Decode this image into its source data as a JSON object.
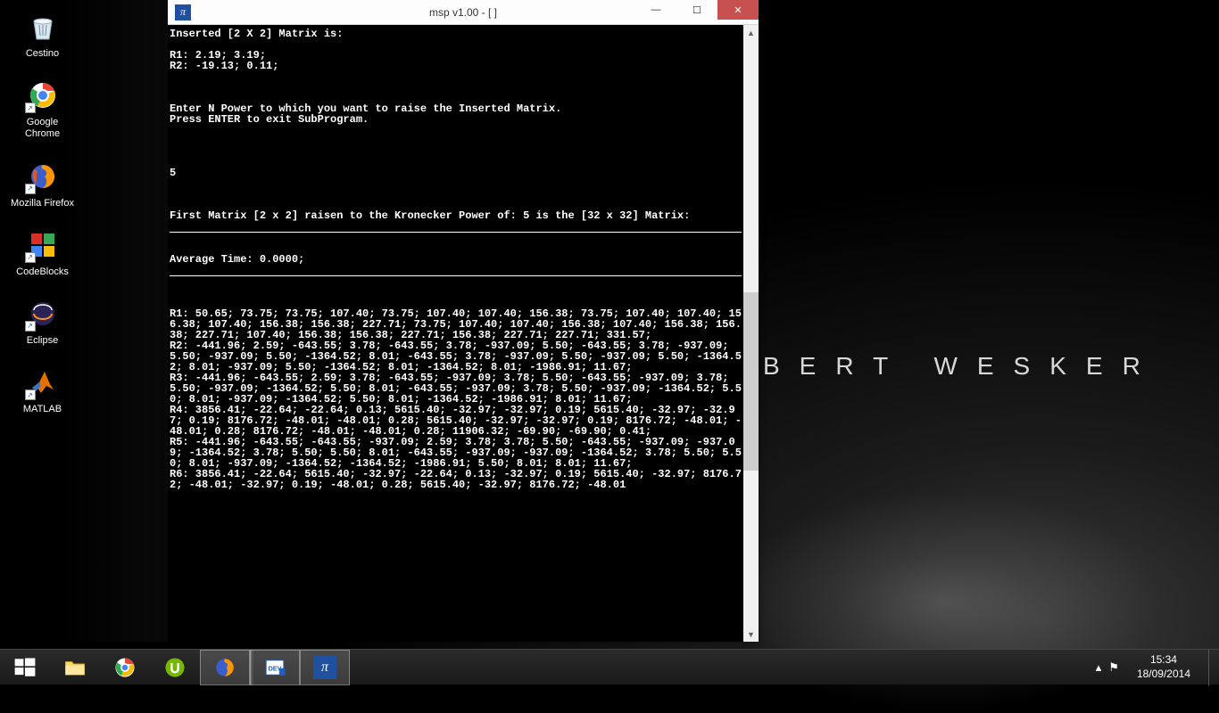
{
  "wallpaper": {
    "text": "BERT WESKER"
  },
  "desktop_icons": [
    {
      "name": "cestino",
      "label": "Cestino"
    },
    {
      "name": "google-chrome",
      "label": "Google Chrome"
    },
    {
      "name": "mozilla-firefox",
      "label": "Mozilla Firefox"
    },
    {
      "name": "codeblocks",
      "label": "CodeBlocks"
    },
    {
      "name": "eclipse",
      "label": "Eclipse"
    },
    {
      "name": "matlab",
      "label": "MATLAB"
    }
  ],
  "window": {
    "title": "msp v1.00 - [  ]",
    "icon_glyph": "π",
    "controls": {
      "min": "—",
      "max": "☐",
      "close": "✕"
    }
  },
  "console": {
    "header_line": "Inserted [2 X 2] Matrix is:",
    "r1": "R1: 2.19; 3.19;",
    "r2": "R2: -19.13; 0.11;",
    "prompt1": "Enter N Power to which you want to raise the Inserted Matrix.",
    "prompt2": "Press ENTER to exit SubProgram.",
    "input_n": "5",
    "result_header": "First Matrix [2 x 2] raisen to the Kronecker Power of: 5 is the [32 x 32] Matrix:",
    "avg_time": "Average Time: 0.0000;",
    "rows": [
      "R1: 50.65; 73.75; 73.75; 107.40; 73.75; 107.40; 107.40; 156.38; 73.75; 107.40; 107.40; 156.38; 107.40; 156.38; 156.38; 227.71; 73.75; 107.40; 107.40; 156.38; 107.40; 156.38; 156.38; 227.71; 107.40; 156.38; 156.38; 227.71; 156.38; 227.71; 227.71; 331.57;",
      "R2: -441.96; 2.59; -643.55; 3.78; -643.55; 3.78; -937.09; 5.50; -643.55; 3.78; -937.09; 5.50; -937.09; 5.50; -1364.52; 8.01; -643.55; 3.78; -937.09; 5.50; -937.09; 5.50; -1364.52; 8.01; -937.09; 5.50; -1364.52; 8.01; -1364.52; 8.01; -1986.91; 11.67;",
      "R3: -441.96; -643.55; 2.59; 3.78; -643.55; -937.09; 3.78; 5.50; -643.55; -937.09; 3.78; 5.50; -937.09; -1364.52; 5.50; 8.01; -643.55; -937.09; 3.78; 5.50; -937.09; -1364.52; 5.50; 8.01; -937.09; -1364.52; 5.50; 8.01; -1364.52; -1986.91; 8.01; 11.67;",
      "R4: 3856.41; -22.64; -22.64; 0.13; 5615.40; -32.97; -32.97; 0.19; 5615.40; -32.97; -32.97; 0.19; 8176.72; -48.01; -48.01; 0.28; 5615.40; -32.97; -32.97; 0.19; 8176.72; -48.01; -48.01; 0.28; 8176.72; -48.01; -48.01; 0.28; 11906.32; -69.90; -69.90; 0.41;",
      "R5: -441.96; -643.55; -643.55; -937.09; 2.59; 3.78; 3.78; 5.50; -643.55; -937.09; -937.09; -1364.52; 3.78; 5.50; 5.50; 8.01; -643.55; -937.09; -937.09; -1364.52; 3.78; 5.50; 5.50; 8.01; -937.09; -1364.52; -1364.52; -1986.91; 5.50; 8.01; 8.01; 11.67;",
      "R6: 3856.41; -22.64; 5615.40; -32.97; -22.64; 0.13; -32.97; 0.19; 5615.40; -32.97; 8176.72; -48.01; -32.97; 0.19; -48.01; 0.28; 5615.40; -32.97; 8176.72; -48.01"
    ]
  },
  "taskbar": {
    "items": [
      {
        "name": "start",
        "label": "Start"
      },
      {
        "name": "file-explorer",
        "label": "File Explorer"
      },
      {
        "name": "chrome",
        "label": "Google Chrome"
      },
      {
        "name": "utorrent",
        "label": "uTorrent"
      },
      {
        "name": "firefox",
        "label": "Firefox"
      },
      {
        "name": "devcpp",
        "label": "Dev-C++"
      },
      {
        "name": "msp",
        "label": "msp"
      }
    ],
    "tray": {
      "chevron": "▴",
      "flag": "⚑"
    },
    "clock": {
      "time": "15:34",
      "date": "18/09/2014"
    }
  }
}
